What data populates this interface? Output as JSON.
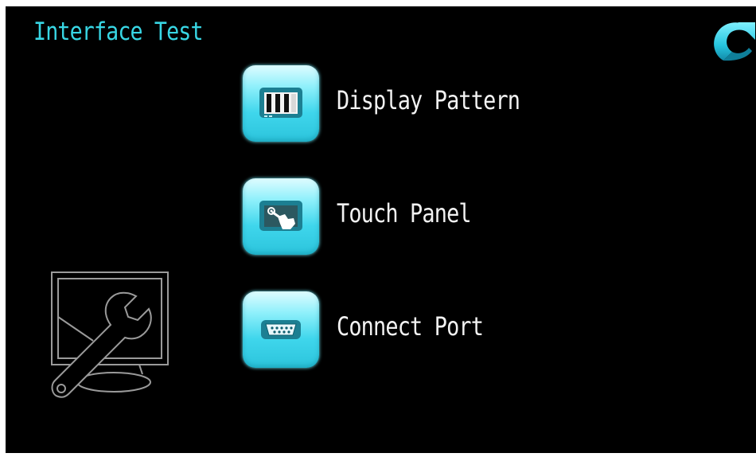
{
  "header": {
    "title": "Interface Test",
    "back_icon": "refresh-back-arrow-icon"
  },
  "menu": {
    "items": [
      {
        "label": "Display Pattern",
        "icon": "display-pattern-icon"
      },
      {
        "label": "Touch Panel",
        "icon": "touch-panel-icon"
      },
      {
        "label": "Connect Port",
        "icon": "serial-port-icon"
      }
    ]
  },
  "decoration": {
    "icon": "monitor-wrench-icon"
  },
  "colors": {
    "background": "#000000",
    "title": "#38d6e4",
    "label": "#f2f2f2",
    "accent": "#3fd6ec"
  }
}
